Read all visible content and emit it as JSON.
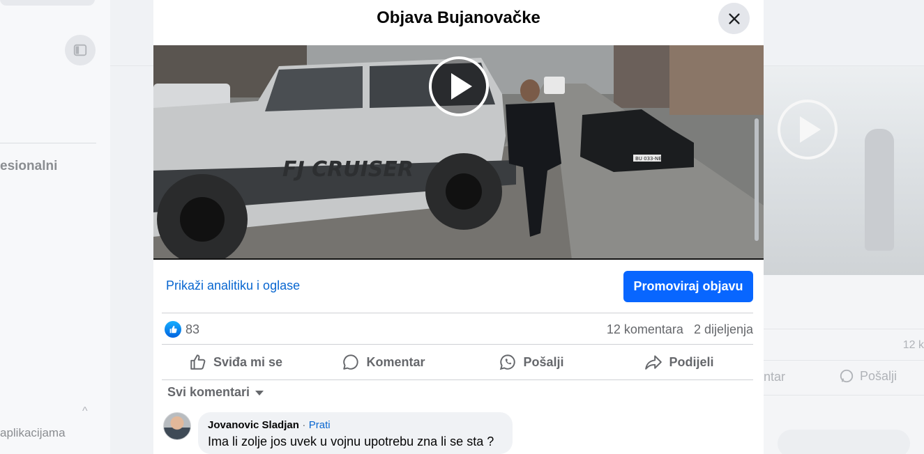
{
  "modal": {
    "title": "Objava Bujanovačke",
    "analytics_link": "Prikaži analitiku i oglase",
    "promote_button": "Promoviraj objavu",
    "reactions": {
      "count": "83",
      "icon": "like-icon"
    },
    "comments_count": "12 komentara",
    "shares_count": "2 dijeljenja",
    "actions": [
      {
        "label": "Sviđa mi se",
        "icon": "thumbs-up-icon"
      },
      {
        "label": "Komentar",
        "icon": "comment-icon"
      },
      {
        "label": "Pošalji",
        "icon": "whatsapp-icon"
      },
      {
        "label": "Podijeli",
        "icon": "share-icon"
      }
    ],
    "sort_label": "Svi komentari",
    "video": {
      "vehicle_text": "FJ CRUISER",
      "plate": "BU 033-NE"
    },
    "comments": [
      {
        "author": "Jovanovic Sladjan",
        "separator": "·",
        "follow": "Prati",
        "text": "Ima li zolje jos uvek u vojnu upotrebu zna li se sta ?"
      }
    ]
  },
  "background": {
    "left_label": "esionalni",
    "left_bottom_label": "aplikacijama",
    "right_count": "12 k",
    "right_action_1": "ntar",
    "right_action_2": "Pošalji"
  },
  "colors": {
    "accent": "#0866ff",
    "link": "#0866d0",
    "muted": "#65676b"
  }
}
